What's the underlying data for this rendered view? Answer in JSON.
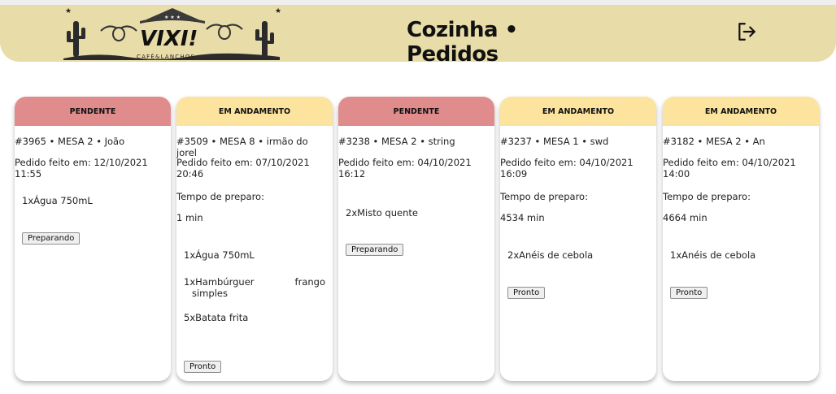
{
  "header": {
    "logo": {
      "name": "VIXI!",
      "tagline": "CAFÉ&LANCHOS"
    },
    "title": "Cozinha • Pedidos",
    "logout_icon": "logout-icon"
  },
  "colors": {
    "header_bg": "#e8dca8",
    "pending": "#e08c8c",
    "in_progress": "#fce39e"
  },
  "orders": [
    {
      "status": "PENDENTE",
      "title": "#3965 • MESA 2 • João",
      "placed": "Pedido feito em: 12/10/2021 11:55",
      "items": [
        "1xÁgua 750mL"
      ],
      "action": "Preparando"
    },
    {
      "status": "EM ANDAMENTO",
      "title": "#3509 • MESA 8 • irmão do jorel",
      "placed": "Pedido feito em: 07/10/2021 20:46",
      "prep_label": "Tempo de preparo:",
      "prep_value": "1 min",
      "items": [
        "1xÁgua 750mL",
        "1xHambúrguer frango simples",
        "5xBatata frita"
      ],
      "action": "Pronto"
    },
    {
      "status": "PENDENTE",
      "title": "#3238 • MESA 2 • string",
      "placed": "Pedido feito em: 04/10/2021 16:12",
      "items": [
        "2xMisto quente"
      ],
      "action": "Preparando"
    },
    {
      "status": "EM ANDAMENTO",
      "title": "#3237 • MESA 1 • swd",
      "placed": "Pedido feito em: 04/10/2021 16:09",
      "prep_label": "Tempo de preparo:",
      "prep_value": "4534 min",
      "items": [
        "2xAnéis de cebola"
      ],
      "action": "Pronto"
    },
    {
      "status": "EM ANDAMENTO",
      "title": "#3182 • MESA 2 • An",
      "placed": "Pedido feito em: 04/10/2021 14:00",
      "prep_label": "Tempo de preparo:",
      "prep_value": "4664 min",
      "items": [
        "1xAnéis de cebola"
      ],
      "action": "Pronto"
    }
  ]
}
